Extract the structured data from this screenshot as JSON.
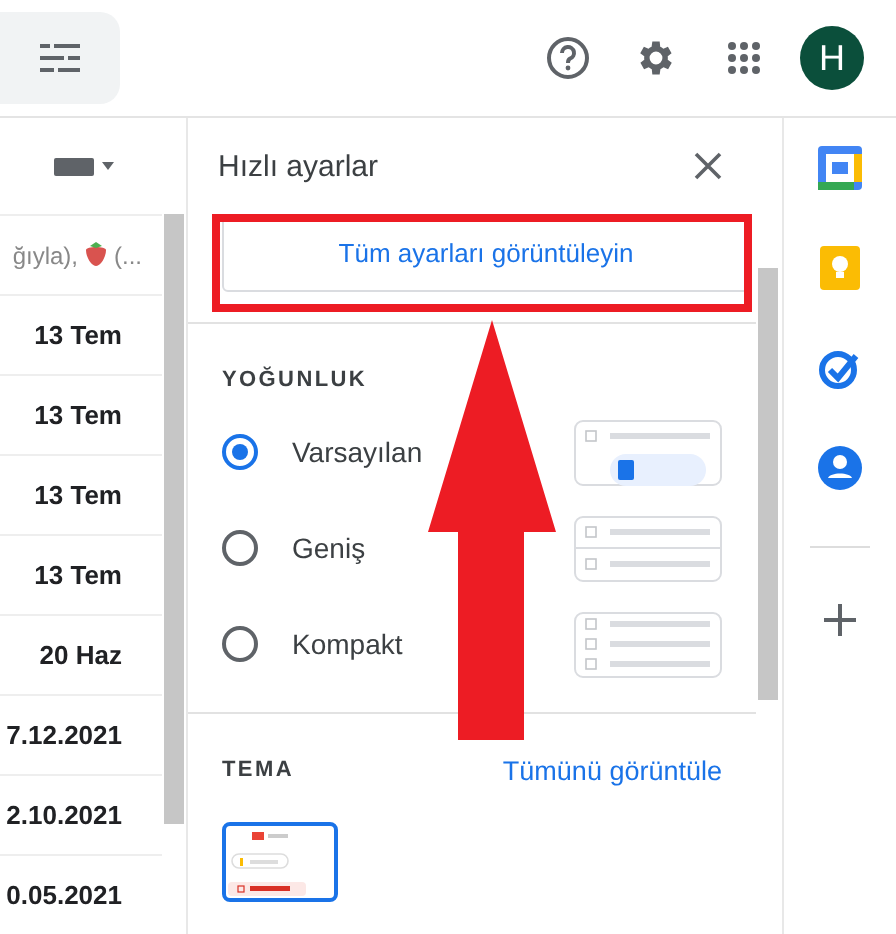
{
  "top_bar": {
    "avatar": "H"
  },
  "mail_list": {
    "snippet": [
      "ğıyla),",
      "(..."
    ],
    "dates": [
      "13 Tem",
      "13 Tem",
      "13 Tem",
      "13 Tem",
      "20 Haz",
      "7.12.2021",
      "2.10.2021",
      "0.05.2021"
    ]
  },
  "quick_settings": {
    "title": "Hızlı ayarlar",
    "all_settings_button": "Tüm ayarları görüntüleyin",
    "density": {
      "heading": "YOĞUNLUK",
      "options": [
        {
          "label": "Varsayılan",
          "selected": true,
          "kind": "default"
        },
        {
          "label": "Geniş",
          "selected": false,
          "kind": "comfortable"
        },
        {
          "label": "Kompakt",
          "selected": false,
          "kind": "compact"
        }
      ]
    },
    "theme": {
      "heading": "TEMA",
      "link": "Tümünü görüntüle"
    }
  }
}
